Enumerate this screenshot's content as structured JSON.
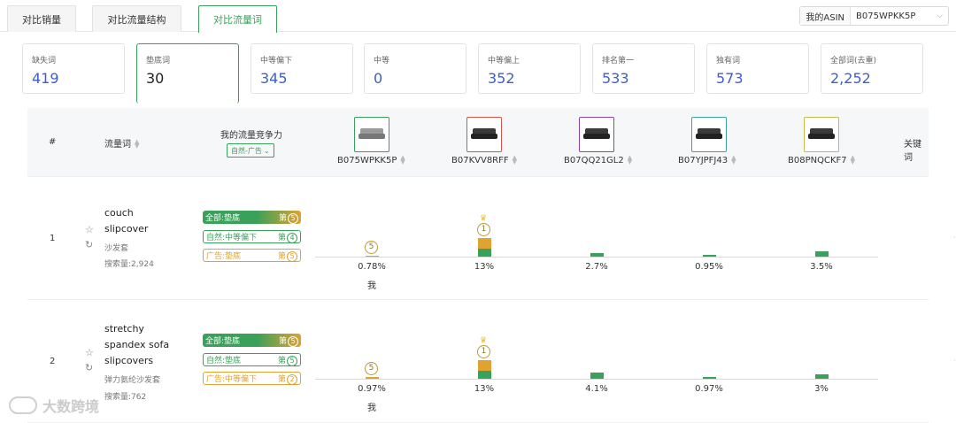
{
  "tabs": [
    {
      "label": "对比销量",
      "active": false
    },
    {
      "label": "对比流量结构",
      "active": false
    },
    {
      "label": "对比流量词",
      "active": true
    }
  ],
  "asin_picker": {
    "label": "我的ASIN",
    "value": "B075WPKK5P"
  },
  "stat_cards": [
    {
      "label": "缺失词",
      "value": "419"
    },
    {
      "label": "垫底词",
      "value": "30",
      "active": true
    },
    {
      "label": "中等偏下",
      "value": "345"
    },
    {
      "label": "中等",
      "value": "0"
    },
    {
      "label": "中等偏上",
      "value": "352"
    },
    {
      "label": "排名第一",
      "value": "533"
    },
    {
      "label": "独有词",
      "value": "573"
    },
    {
      "label": "全部词(去重)",
      "value": "2,252"
    }
  ],
  "table_header": {
    "index": "#",
    "keyword": "流量词",
    "competitiveness": "我的流量竞争力",
    "competitiveness_filter": "自然-广告",
    "last_col": "关键词",
    "products": [
      "B075WPKK5P",
      "B07KVV8RFF",
      "B07QQ21GL2",
      "B07YJPFJ43",
      "B08PNQCKF7"
    ]
  },
  "product_border_colors": [
    "#3aa15a",
    "#d9534f",
    "#8e44ad",
    "#3aa1a0",
    "#c9b84a"
  ],
  "colors": {
    "accent_green": "#3aa15a",
    "accent_orange": "#e0a230",
    "link_blue": "#3d5fc7"
  },
  "rows": [
    {
      "index": "1",
      "keyword_lines": [
        "couch",
        "slipcover"
      ],
      "keyword_cn": "沙发套",
      "search_volume": "搜索量:2,924",
      "tags": [
        {
          "text": "全部:垫底",
          "rank": "5",
          "style": "solid"
        },
        {
          "text": "自然:中等偏下",
          "rank": "4",
          "style": "green"
        },
        {
          "text": "广告:垫底",
          "rank": "5",
          "style": "orange"
        }
      ],
      "shares": [
        "0.78%",
        "13%",
        "2.7%",
        "0.95%",
        "3.5%"
      ],
      "share_values": [
        0.78,
        13,
        2.7,
        0.95,
        3.5
      ],
      "ranks": [
        "5",
        "1",
        "",
        "",
        ""
      ],
      "me_label": "我"
    },
    {
      "index": "2",
      "keyword_lines": [
        "stretchy",
        "spandex sofa",
        "slipcovers"
      ],
      "keyword_cn": "弹力氨纶沙发套",
      "search_volume": "搜索量:762",
      "tags": [
        {
          "text": "全部:垫底",
          "rank": "5",
          "style": "solid"
        },
        {
          "text": "自然:垫底",
          "rank": "5",
          "style": "green"
        },
        {
          "text": "广告:中等偏下",
          "rank": "2",
          "style": "orange"
        }
      ],
      "shares": [
        "0.97%",
        "13%",
        "4.1%",
        "0.97%",
        "3%"
      ],
      "share_values": [
        0.97,
        13,
        4.1,
        0.97,
        3
      ],
      "ranks": [
        "5",
        "1",
        "",
        "",
        ""
      ],
      "me_label": "我"
    }
  ],
  "watermark": "大数跨境"
}
